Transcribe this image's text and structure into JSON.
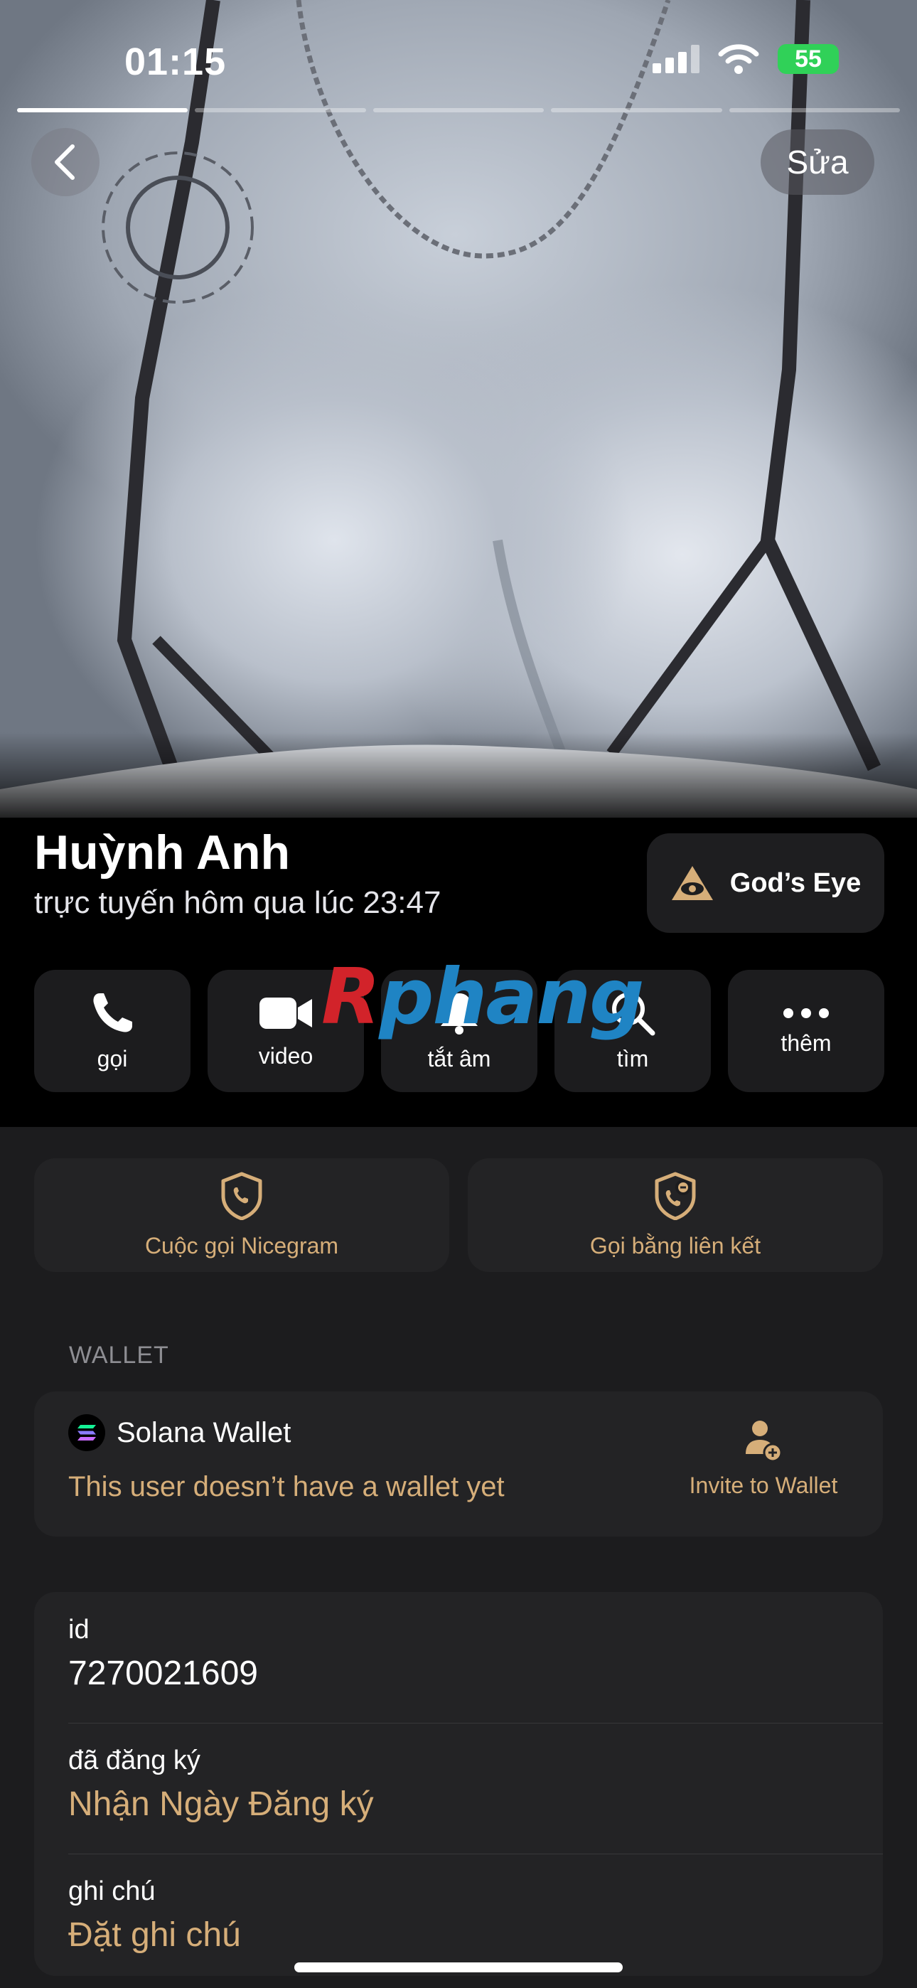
{
  "status_bar": {
    "time": "01:15",
    "battery": "55",
    "icons": [
      "cellular-signal-icon",
      "wifi-icon",
      "battery-charging-icon"
    ]
  },
  "story": {
    "segments": 5,
    "active_segment": 1
  },
  "header": {
    "back_icon": "chevron-left-icon",
    "edit_label": "Sửa"
  },
  "profile": {
    "name": "Huỳnh Anh",
    "status": "trực tuyến hôm qua lúc 23:47"
  },
  "gods_eye": {
    "label": "God’s Eye",
    "icon": "eye-pyramid-icon"
  },
  "actions": [
    {
      "label": "gọi",
      "icon": "phone-icon"
    },
    {
      "label": "video",
      "icon": "video-camera-icon"
    },
    {
      "label": "tắt âm",
      "icon": "bell-icon"
    },
    {
      "label": "tìm",
      "icon": "search-icon"
    },
    {
      "label": "thêm",
      "icon": "more-dots-icon"
    }
  ],
  "watermark": {
    "part1": "R",
    "part2": "phang"
  },
  "call_options": [
    {
      "label": "Cuộc gọi Nicegram",
      "icon": "shield-phone-icon"
    },
    {
      "label": "Gọi bằng liên kết",
      "icon": "shield-link-phone-icon"
    }
  ],
  "wallet": {
    "section_title": "WALLET",
    "title": "Solana Wallet",
    "message": "This user doesn’t have a wallet yet",
    "invite_label": "Invite to Wallet",
    "invite_icon": "add-user-icon"
  },
  "info": {
    "id_label": "id",
    "id_value": "7270021609",
    "registered_label": "đã đăng ký",
    "registered_value": "Nhận Ngày Đăng ký",
    "note_label": "ghi chú",
    "note_value": "Đặt ghi chú"
  },
  "colors": {
    "accent_gold": "#d6ae79",
    "background": "#1c1c1e",
    "card": "#232325",
    "battery_green": "#30d158"
  }
}
